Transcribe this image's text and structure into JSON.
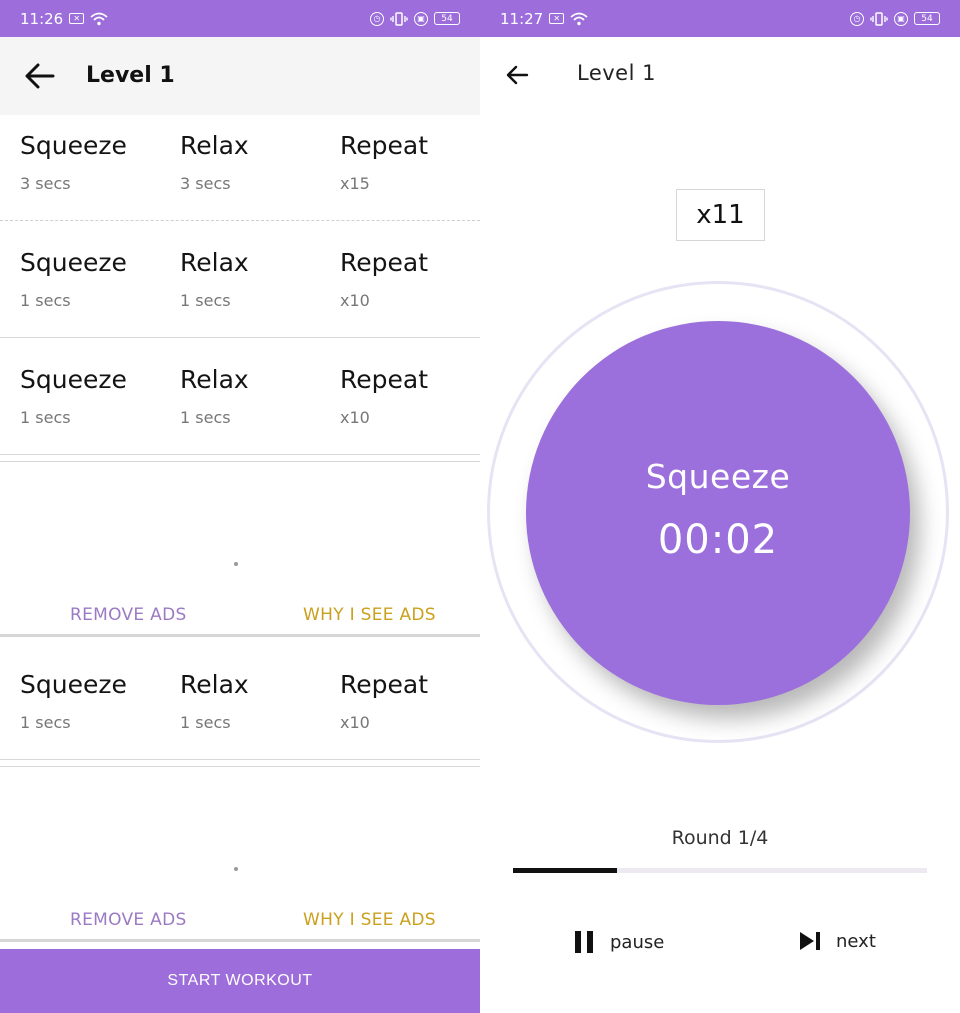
{
  "left": {
    "status": {
      "time": "11:26",
      "battery": "54"
    },
    "header": {
      "title": "Level 1"
    },
    "exercises": [
      {
        "squeeze_label": "Squeeze",
        "squeeze_value": "3 secs",
        "relax_label": "Relax",
        "relax_value": "3 secs",
        "repeat_label": "Repeat",
        "repeat_value": "x15"
      },
      {
        "squeeze_label": "Squeeze",
        "squeeze_value": "1 secs",
        "relax_label": "Relax",
        "relax_value": "1 secs",
        "repeat_label": "Repeat",
        "repeat_value": "x10"
      },
      {
        "squeeze_label": "Squeeze",
        "squeeze_value": "1 secs",
        "relax_label": "Relax",
        "relax_value": "1 secs",
        "repeat_label": "Repeat",
        "repeat_value": "x10"
      },
      {
        "squeeze_label": "Squeeze",
        "squeeze_value": "1 secs",
        "relax_label": "Relax",
        "relax_value": "1 secs",
        "repeat_label": "Repeat",
        "repeat_value": "x10"
      }
    ],
    "ads": [
      {
        "remove_label": "REMOVE ADS",
        "why_label": "WHY I SEE ADS"
      },
      {
        "remove_label": "REMOVE ADS",
        "why_label": "WHY I SEE ADS"
      }
    ],
    "start_button": "START WORKOUT"
  },
  "right": {
    "status": {
      "time": "11:27",
      "battery": "54"
    },
    "header": {
      "title": "Level 1"
    },
    "repetitions": "x11",
    "phase": "Squeeze",
    "timer": "00:02",
    "round": "Round 1/4",
    "round_progress": 0.25,
    "controls": {
      "pause_label": "pause",
      "next_label": "next"
    }
  },
  "colors": {
    "accent": "#9c6ddb",
    "circle": "#9b6fdc",
    "remove_ads": "#9b7ac3",
    "why_ads": "#caa01c"
  },
  "icons": {
    "back": "arrow-left-icon",
    "pause": "pause-icon",
    "next": "skip-next-icon"
  }
}
